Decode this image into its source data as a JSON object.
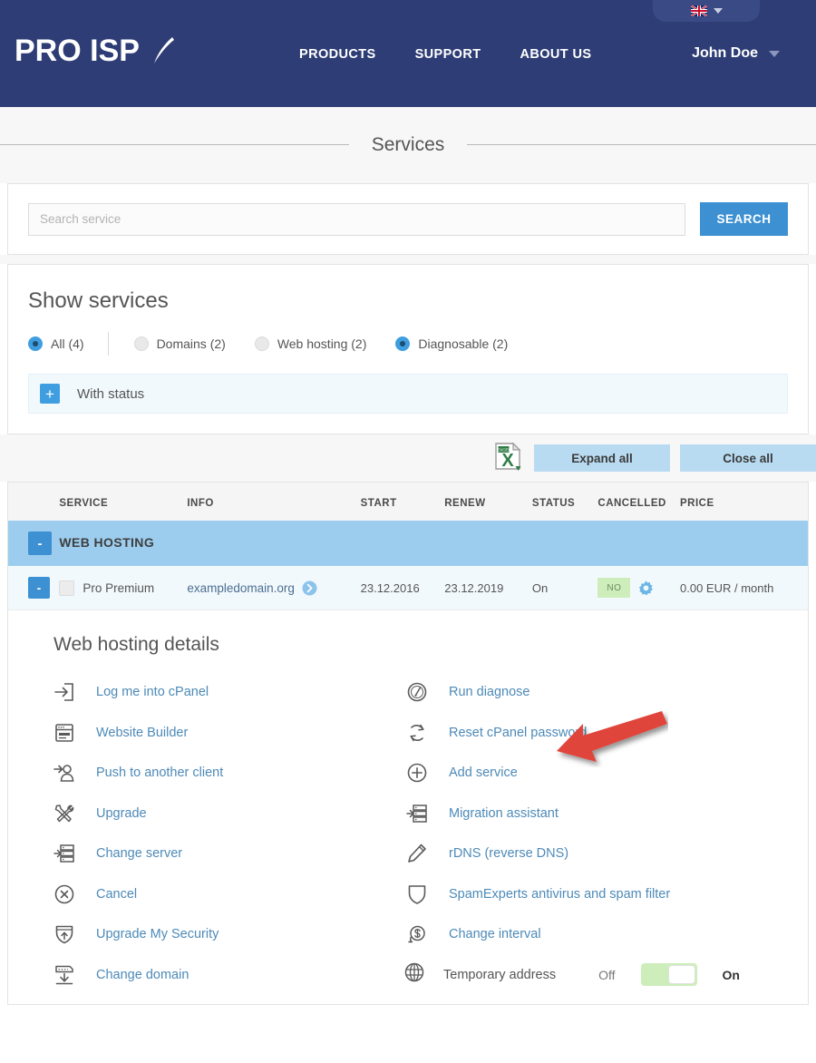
{
  "header": {
    "logo_text": "PRO ISP",
    "logo_icon": "swoosh-icon",
    "language_flag": "uk-flag-icon",
    "nav": [
      {
        "label": "PRODUCTS"
      },
      {
        "label": "SUPPORT"
      },
      {
        "label": "ABOUT US"
      }
    ],
    "user_name": "John Doe",
    "brand_navy": "#2e3d75"
  },
  "page": {
    "title": "Services"
  },
  "search": {
    "placeholder": "Search service",
    "value": "",
    "button_label": "SEARCH",
    "button_color": "#3d90d2"
  },
  "filters": {
    "title": "Show services",
    "options": [
      {
        "label": "All (4)",
        "selected": true
      },
      {
        "label": "Domains (2)",
        "selected": false
      },
      {
        "label": "Web hosting (2)",
        "selected": false
      },
      {
        "label": "Diagnosable (2)",
        "selected": true
      }
    ],
    "with_status": {
      "expand_icon": "plus-icon",
      "label": "With status"
    }
  },
  "toolbar": {
    "export_icon": "excel-export-icon",
    "expand_all_label": "Expand all",
    "close_all_label": "Close all",
    "button_color": "#b9dbf2"
  },
  "table": {
    "columns": [
      "SERVICE",
      "INFO",
      "START",
      "RENEW",
      "STATUS",
      "CANCELLED",
      "PRICE"
    ],
    "group": {
      "toggle": "-",
      "name": "WEB HOSTING",
      "color": "#9ccdee"
    },
    "rows": [
      {
        "toggle": "-",
        "checkbox": false,
        "service": "Pro Premium",
        "info": "exampledomain.org",
        "info_icon": "arrow-circle-right-icon",
        "start": "23.12.2016",
        "renew": "23.12.2019",
        "status": "On",
        "cancelled": "NO",
        "cancelled_color": "#cdeeba",
        "settings_icon": "gear-icon",
        "price": "0.00 EUR / month"
      }
    ]
  },
  "details": {
    "title": "Web hosting details",
    "left_actions": [
      {
        "icon": "login-arrow-icon",
        "label": "Log me into cPanel"
      },
      {
        "icon": "browser-window-icon",
        "label": "Website Builder"
      },
      {
        "icon": "push-user-icon",
        "label": "Push to another client"
      },
      {
        "icon": "tools-icon",
        "label": "Upgrade"
      },
      {
        "icon": "server-stack-icon",
        "label": "Change server"
      },
      {
        "icon": "x-circle-icon",
        "label": "Cancel"
      },
      {
        "icon": "shield-up-arrow-icon",
        "label": "Upgrade My Security"
      },
      {
        "icon": "download-domain-icon",
        "label": "Change domain"
      }
    ],
    "right_actions": [
      {
        "icon": "gauge-icon",
        "label": "Run diagnose"
      },
      {
        "icon": "refresh-icon",
        "label": "Reset cPanel password"
      },
      {
        "icon": "plus-circle-icon",
        "label": "Add service"
      },
      {
        "icon": "server-stack-icon",
        "label": "Migration assistant"
      },
      {
        "icon": "pencil-icon",
        "label": "rDNS (reverse DNS)"
      },
      {
        "icon": "shield-icon",
        "label": "SpamExperts antivirus and spam filter"
      },
      {
        "icon": "dollar-refresh-icon",
        "label": "Change interval"
      }
    ],
    "temporary_address": {
      "icon": "globe-icon",
      "label": "Temporary address",
      "off_label": "Off",
      "on_label": "On",
      "state": "On",
      "track_color": "#cdeeba"
    },
    "link_color": "#4d8ab8"
  },
  "annotation": {
    "arrow_target": "Run diagnose",
    "color": "#e0453a"
  }
}
